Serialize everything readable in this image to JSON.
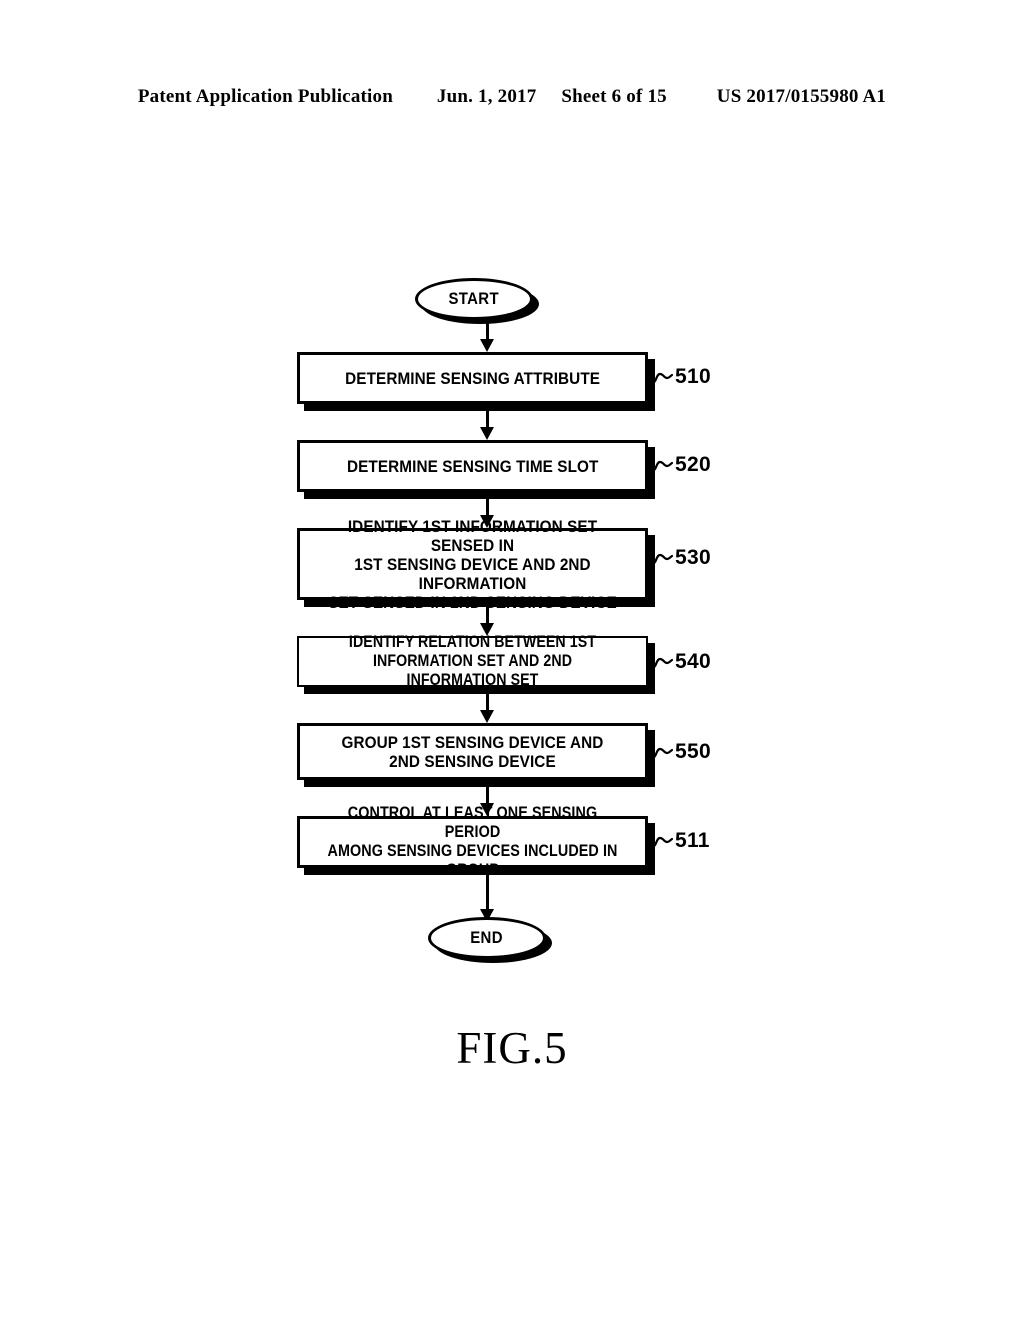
{
  "header": {
    "publication": "Patent Application Publication",
    "date": "Jun. 1, 2017",
    "sheet": "Sheet 6 of 15",
    "patent_number": "US 2017/0155980 A1"
  },
  "figure": {
    "caption": "FIG.5",
    "start_label": "START",
    "end_label": "END",
    "steps": [
      {
        "ref": "510",
        "text": "DETERMINE SENSING ATTRIBUTE"
      },
      {
        "ref": "520",
        "text": "DETERMINE SENSING TIME SLOT"
      },
      {
        "ref": "530",
        "text": "IDENTIFY 1ST INFORMATION SET SENSED IN\n1ST SENSING DEVICE AND 2ND INFORMATION\nSET SENSED IN 2ND SENSING DEVICE"
      },
      {
        "ref": "540",
        "text": "IDENTIFY RELATION BETWEEN 1ST\nINFORMATION SET AND 2ND INFORMATION SET"
      },
      {
        "ref": "550",
        "text": "GROUP 1ST SENSING DEVICE AND\n2ND SENSING DEVICE"
      },
      {
        "ref": "511",
        "text": "CONTROL AT LEAST ONE SENSING PERIOD\nAMONG SENSING DEVICES INCLUDED IN GROUP"
      }
    ]
  },
  "colors": {
    "ink": "#000000",
    "page": "#ffffff"
  }
}
